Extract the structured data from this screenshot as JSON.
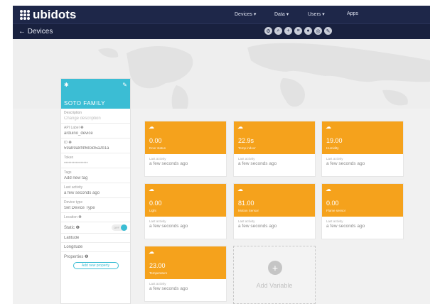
{
  "app": {
    "logo_text": "ubidots"
  },
  "nav": {
    "devices": "Devices ▾",
    "data": "Data ▾",
    "users": "Users ▾",
    "apps": "Apps"
  },
  "breadcrumb": "← Devices",
  "toolbar_icons": [
    "settings-icon",
    "search-icon",
    "add-icon",
    "list-icon",
    "user-icon",
    "globe-icon",
    "pencil-icon"
  ],
  "device": {
    "name": "SOTO FAMILY",
    "fields": [
      {
        "label": "Description",
        "value": "Change description",
        "placeholder": true
      },
      {
        "label": "API Label ❶",
        "value": "arduino_device"
      },
      {
        "label": "ID ❶",
        "value": "59ab9a8f4f6b3d5a2b1a"
      },
      {
        "label": "Token",
        "value": "••••••••••••••••",
        "placeholder": true
      },
      {
        "label": "Tags",
        "value": "Add new tag"
      },
      {
        "label": "Last activity",
        "value": "a few seconds ago"
      },
      {
        "label": "Device type",
        "value": "Set Device Type"
      },
      {
        "label": "Location ❶",
        "value": ""
      }
    ],
    "static_label": "Static ❶",
    "static_toggle": "OFF",
    "latitude_label": "Latitude",
    "longitude_label": "Longitude",
    "properties_label": "Properties ❶",
    "add_property": "Add new property"
  },
  "variables": [
    {
      "value": "0.00",
      "name": "Door status",
      "last_label": "Last activity",
      "time": "a few seconds ago"
    },
    {
      "value": "22.9s",
      "name": "Temp indoor",
      "last_label": "Last activity",
      "time": "a few seconds ago"
    },
    {
      "value": "19.00",
      "name": "Humidity",
      "last_label": "Last activity",
      "time": "a few seconds ago"
    },
    {
      "value": "0.00",
      "name": "Light",
      "last_label": "Last activity",
      "time": "a few seconds ago"
    },
    {
      "value": "81.00",
      "name": "Motion Sensor",
      "last_label": "Last activity",
      "time": "a few seconds ago"
    },
    {
      "value": "0.00",
      "name": "Flame sensor",
      "last_label": "Last activity",
      "time": "a few seconds ago"
    },
    {
      "value": "23.00",
      "name": "Temperature",
      "last_label": "Last activity",
      "time": "a few seconds ago"
    }
  ],
  "add_variable": "Add Variable",
  "colors": {
    "navbar": "#1e2749",
    "panel_accent": "#3bbdd4",
    "card_accent": "#f5a21c"
  }
}
